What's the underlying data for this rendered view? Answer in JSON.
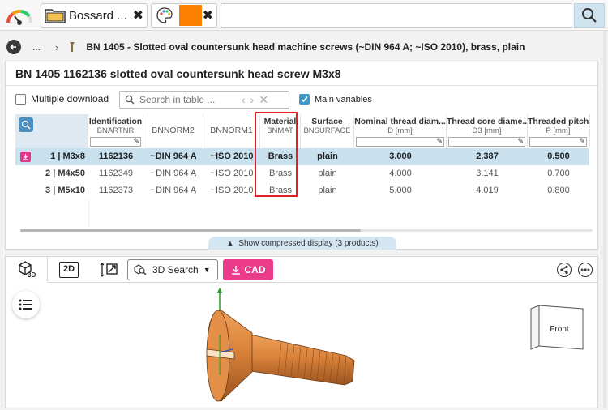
{
  "tabs": [
    {
      "label": "Bossard ...",
      "close": "✖"
    },
    {
      "label": "",
      "close": "✖",
      "swatch_color": "#ff7f00"
    }
  ],
  "breadcrumb": {
    "ellipsis": "...",
    "title": "BN 1405 - Slotted oval countersunk head machine screws (~DIN 964 A; ~ISO 2010), brass, plain"
  },
  "panel": {
    "title": "BN 1405 1162136 slotted oval countersunk head screw M3x8",
    "multiple_download": "Multiple download",
    "search_placeholder": "Search in table ...",
    "main_variables": "Main variables",
    "compressed": "Show compressed display (3 products)"
  },
  "table": {
    "columns": [
      {
        "title": "Identification",
        "code": "BNARTNR",
        "filter": true
      },
      {
        "title": "BNNORM2",
        "code": "",
        "filter": false
      },
      {
        "title": "BNNORM1",
        "code": "",
        "filter": false
      },
      {
        "title": "Material",
        "code": "BNMAT",
        "filter": false
      },
      {
        "title": "Surface",
        "code": "BNSURFACE",
        "filter": false
      },
      {
        "title": "Nominal thread diam...",
        "code": "D [mm]",
        "filter": true
      },
      {
        "title": "Thread core diame...",
        "code": "D3 [mm]",
        "filter": true
      },
      {
        "title": "Threaded pitch",
        "code": "P [mm]",
        "filter": true
      }
    ],
    "rows": [
      {
        "label": "1 | M3x8",
        "cells": [
          "1162136",
          "~DIN 964 A",
          "~ISO 2010",
          "Brass",
          "plain",
          "3.000",
          "2.387",
          "0.500"
        ]
      },
      {
        "label": "2 | M4x50",
        "cells": [
          "1162349",
          "~DIN 964 A",
          "~ISO 2010",
          "Brass",
          "plain",
          "4.000",
          "3.141",
          "0.700"
        ]
      },
      {
        "label": "3 | M5x10",
        "cells": [
          "1162373",
          "~DIN 964 A",
          "~ISO 2010",
          "Brass",
          "plain",
          "5.000",
          "4.019",
          "0.800"
        ]
      }
    ]
  },
  "viewer": {
    "tab_3d": "3D",
    "tab_2d": "2D",
    "search_3d": "3D Search",
    "cad": "CAD",
    "cube_front": "Front"
  },
  "colors": {
    "accent": "#3a9ac9",
    "cad_button": "#ec3b8b",
    "highlight_box": "#e0202a",
    "brass": "#d9823a"
  }
}
